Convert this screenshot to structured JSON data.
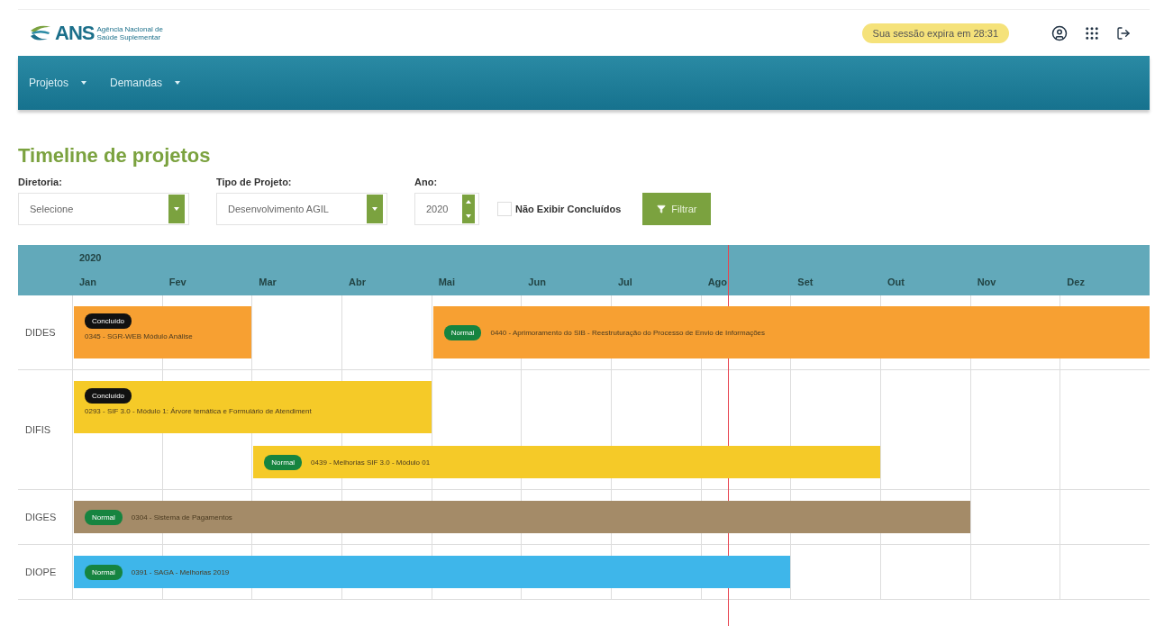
{
  "logo": {
    "mark": "ANS",
    "line_1": "Agência Nacional de",
    "line_2": "Saúde Suplementar"
  },
  "session": {
    "text": "Sua sessão expira em 28:31"
  },
  "nav": [
    {
      "label": "Projetos"
    },
    {
      "label": "Demandas"
    }
  ],
  "page_title": "Timeline de projetos",
  "filters": {
    "diretoria": {
      "label": "Diretoria:",
      "value": "Selecione"
    },
    "tipo": {
      "label": "Tipo de Projeto:",
      "value": "Desenvolvimento AGIL"
    },
    "ano": {
      "label": "Ano:",
      "value": "2020"
    },
    "hide_done": {
      "label": "Não Exibir Concluídos",
      "checked": false
    },
    "button": "Filtrar"
  },
  "timeline": {
    "year": "2020",
    "months": [
      "Jan",
      "Fev",
      "Mar",
      "Abr",
      "Mai",
      "Jun",
      "Jul",
      "Ago",
      "Set",
      "Out",
      "Nov",
      "Dez"
    ],
    "rows": [
      {
        "label": "DIDES",
        "lanes": [
          [
            {
              "color": "#f7a032",
              "kind": "done",
              "badge": "Concluído",
              "text": "0345 - SGR-WEB Módulo Análise"
            },
            {
              "color": "#f7a032",
              "kind": "normal",
              "badge": "Normal",
              "text": "0440 - Aprimoramento do SIB - Reestruturação do Processo de Envio de Informações"
            }
          ]
        ]
      },
      {
        "label": "DIFIS",
        "lanes": [
          [
            {
              "color": "#f5ca28",
              "kind": "done",
              "badge": "Concluído",
              "text": "0293 - SIF 3.0 - Módulo 1: Árvore temática e Formulário de Atendiment"
            }
          ],
          [
            {
              "color": "#f5ca28",
              "kind": "normal",
              "badge": "Normal",
              "text": "0439 - Melhorias SIF 3.0 - Módulo 01"
            }
          ]
        ]
      },
      {
        "label": "DIGES",
        "lanes": [
          [
            {
              "color": "#a48b68",
              "kind": "normal",
              "badge": "Normal",
              "text": "0304 - Sistema de Pagamentos"
            }
          ]
        ]
      },
      {
        "label": "DIOPE",
        "lanes": [
          [
            {
              "color": "#3eb6ea",
              "kind": "normal",
              "badge": "Normal",
              "text": "0391 - SAGA - Melhorias 2019"
            }
          ]
        ]
      }
    ]
  }
}
